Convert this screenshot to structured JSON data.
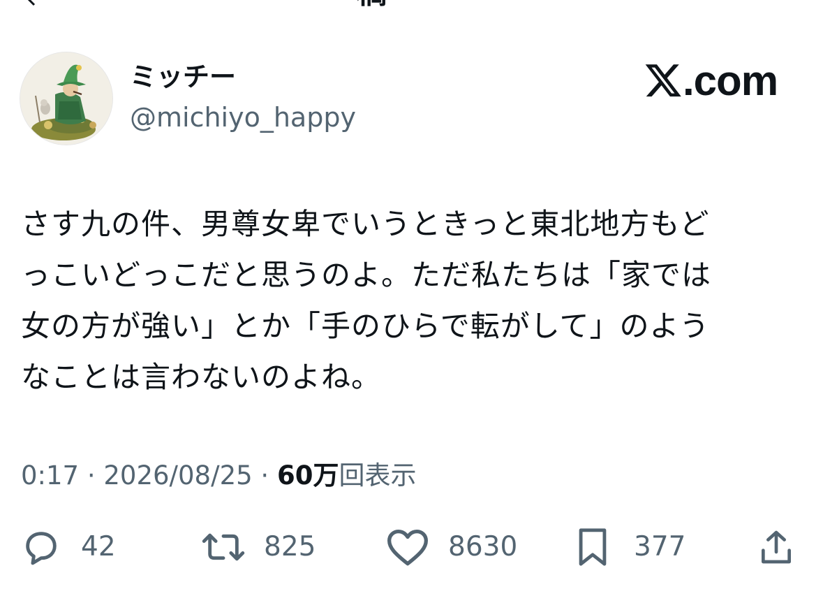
{
  "header": {
    "title_fragment": "稿",
    "back_icon": "chevron-left-icon"
  },
  "author": {
    "display_name": "ミッチー",
    "handle": "@michiyo_happy",
    "avatar": "snufkin-avatar"
  },
  "watermark": {
    "text": ".com",
    "logo_icon": "x-logo-icon"
  },
  "tweet": {
    "lines": [
      "さす九の件、男尊女卑でいうときっと東北地方もど",
      "っこいどっこだと思うのよ。ただ私たちは「家では",
      "女の方が強い」とか「手のひらで転がして」のよう",
      "なことは言わないのよね。"
    ]
  },
  "meta": {
    "time": "0:17",
    "separator": "·",
    "date": "2026/08/25",
    "views_count": "60万",
    "views_label": "回表示"
  },
  "actions": {
    "reply_count": "42",
    "retweet_count": "825",
    "like_count": "8630",
    "bookmark_count": "377"
  },
  "colors": {
    "text": "#0f1419",
    "secondary": "#536471"
  }
}
